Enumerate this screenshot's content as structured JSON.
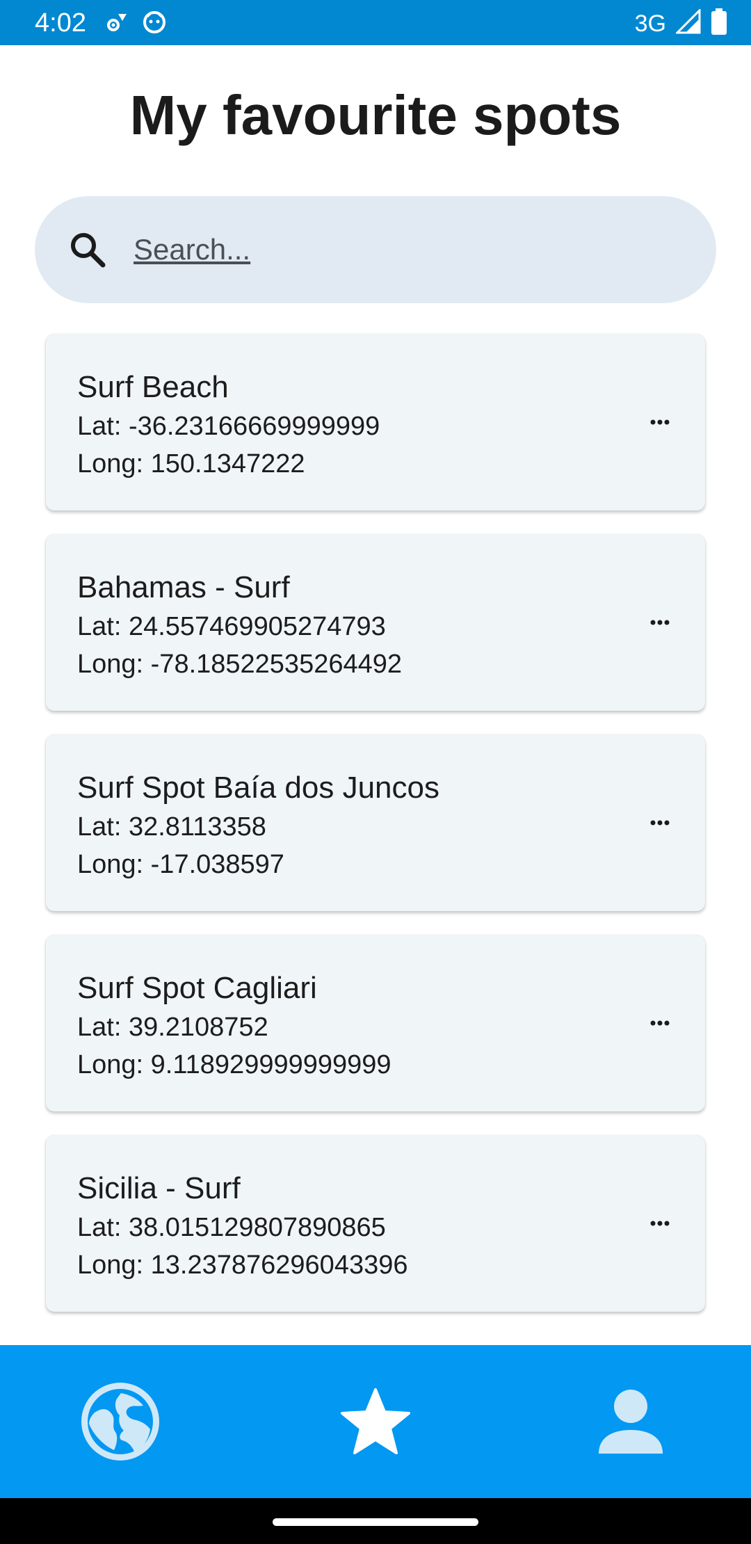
{
  "status_bar": {
    "time": "4:02",
    "network": "3G"
  },
  "page": {
    "title": "My favourite spots"
  },
  "search": {
    "placeholder": "Search...",
    "value": ""
  },
  "spots": [
    {
      "name": "Surf Beach",
      "lat": "Lat: -36.23166669999999",
      "long": "Long: 150.1347222"
    },
    {
      "name": "Bahamas - Surf",
      "lat": "Lat: 24.557469905274793",
      "long": "Long: -78.18522535264492"
    },
    {
      "name": "Surf Spot Baía dos Juncos",
      "lat": "Lat: 32.8113358",
      "long": "Long: -17.038597"
    },
    {
      "name": "Surf Spot Cagliari",
      "lat": "Lat: 39.2108752",
      "long": "Long: 9.118929999999999"
    },
    {
      "name": "Sicilia - Surf",
      "lat": "Lat: 38.015129807890865",
      "long": "Long: 13.237876296043396"
    }
  ],
  "bottom_nav": {
    "items": [
      {
        "icon": "globe-icon",
        "active": false
      },
      {
        "icon": "star-icon",
        "active": true
      },
      {
        "icon": "person-icon",
        "active": false
      }
    ]
  },
  "colors": {
    "status_bar": "#0288d1",
    "nav_bar": "#0398f2",
    "search_bg": "#e1eaf2",
    "card_bg": "#f0f5f7"
  }
}
